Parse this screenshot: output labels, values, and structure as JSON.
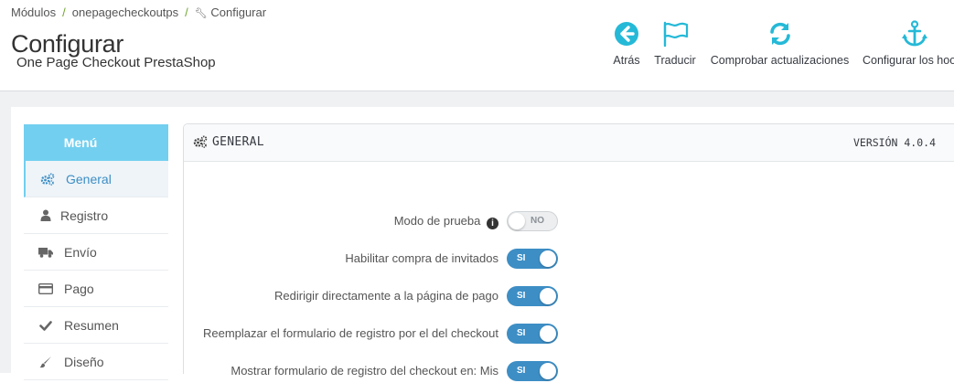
{
  "breadcrumb": {
    "items": [
      "Módulos",
      "onepagecheckoutps",
      "Configurar"
    ],
    "separator": "/"
  },
  "header": {
    "title": "Configurar",
    "subtitle": "One Page Checkout PrestaShop"
  },
  "toolbar": {
    "back_label": "Atrás",
    "translate_label": "Traducir",
    "check_updates_label": "Comprobar actualizaciones",
    "hooks_label": "Configurar los hooks",
    "icons": [
      "arrow-circle-left-icon",
      "flag-icon",
      "refresh-icon",
      "anchor-icon"
    ],
    "icon_color": "#25b9d7"
  },
  "sidebar": {
    "header": "Menú",
    "accent_color": "#72cfef",
    "items": [
      {
        "label": "General",
        "icon": "cogs-icon",
        "active": true
      },
      {
        "label": "Registro",
        "icon": "user-icon",
        "active": false
      },
      {
        "label": "Envío",
        "icon": "truck-icon",
        "active": false
      },
      {
        "label": "Pago",
        "icon": "credit-card-icon",
        "active": false
      },
      {
        "label": "Resumen",
        "icon": "check-icon",
        "active": false
      },
      {
        "label": "Diseño",
        "icon": "paint-brush-icon",
        "active": false
      }
    ]
  },
  "panel": {
    "title": "GENERAL",
    "version": "VERSIÓN 4.0.4",
    "switch_on_color": "#3d8ec5",
    "rows": [
      {
        "label": "Modo de prueba",
        "value": "NO",
        "on": false,
        "has_info": true
      },
      {
        "label": "Habilitar compra de invitados",
        "value": "SI",
        "on": true
      },
      {
        "label": "Redirigir directamente a la página de pago",
        "value": "SI",
        "on": true
      },
      {
        "label": "Reemplazar el formulario de registro por el del checkout",
        "value": "SI",
        "on": true
      },
      {
        "label": "Mostrar formulario de registro del checkout en: Mis",
        "value": "SI",
        "on": true
      }
    ]
  }
}
